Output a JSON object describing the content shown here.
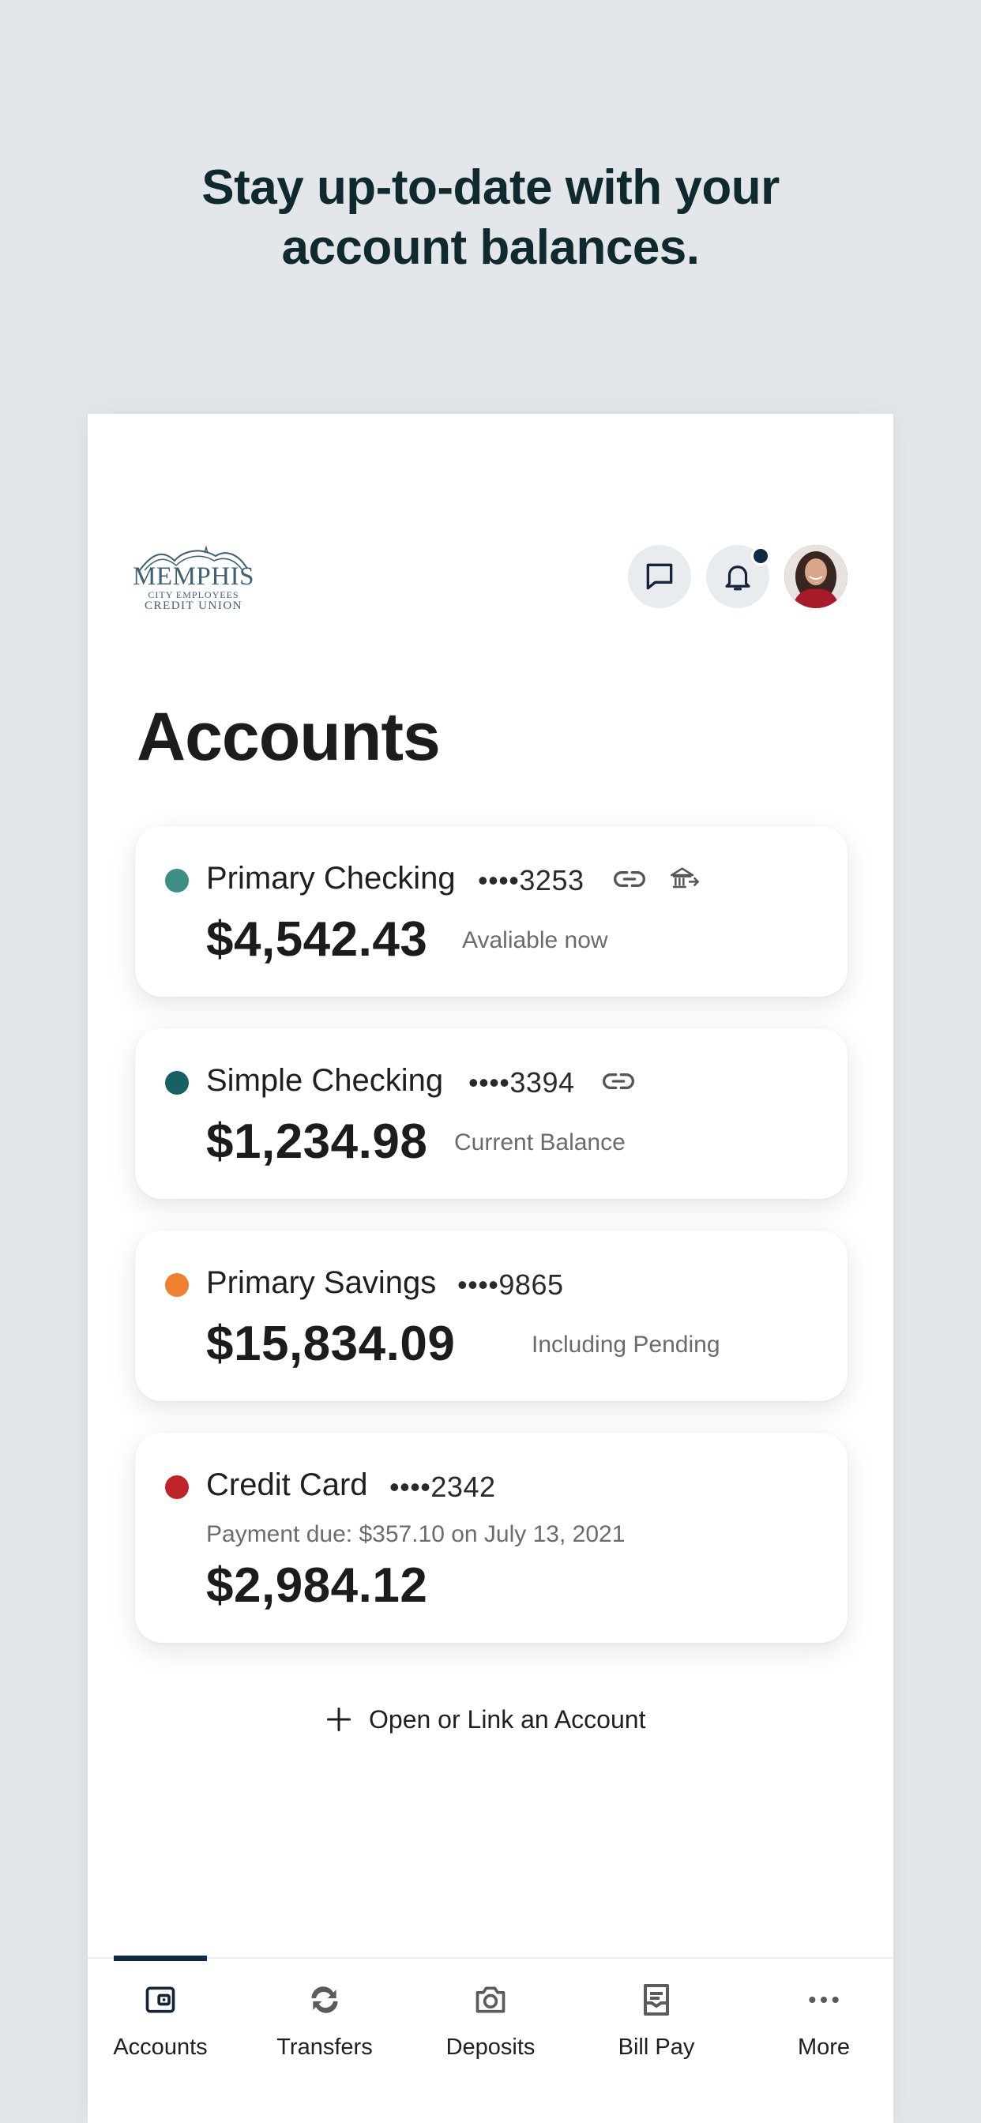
{
  "headline": {
    "line1": "Stay up-to-date with your",
    "line2": "account balances."
  },
  "logo": {
    "line1": "MEMPHIS",
    "line2": "CITY EMPLOYEES",
    "line3": "CREDIT UNION"
  },
  "header": {
    "icons": [
      "chat-icon",
      "bell-icon",
      "profile-avatar"
    ],
    "has_notification": true
  },
  "page_title": "Accounts",
  "accounts": [
    {
      "name": "Primary Checking",
      "masked": "••••3253",
      "amount": "$4,542.43",
      "note": "Avaliable now",
      "color": "#3d8f86",
      "icons": [
        "link-icon",
        "bank-transfer-icon"
      ]
    },
    {
      "name": "Simple Checking",
      "masked": "••••3394",
      "amount": "$1,234.98",
      "note": "Current Balance",
      "color": "#176066",
      "icons": [
        "link-icon"
      ]
    },
    {
      "name": "Primary Savings",
      "masked": "••••9865",
      "amount": "$15,834.09",
      "note": "Including Pending",
      "color": "#f08030",
      "icons": []
    },
    {
      "name": "Credit Card",
      "masked": "••••2342",
      "due_text": "Payment due: $357.10 on July 13, 2021",
      "amount": "$2,984.12",
      "color": "#c0232a",
      "icons": []
    }
  ],
  "open_link_label": "Open or Link an Account",
  "tabs": [
    {
      "label": "Accounts",
      "icon": "wallet-icon",
      "active": true
    },
    {
      "label": "Transfers",
      "icon": "transfer-icon",
      "active": false
    },
    {
      "label": "Deposits",
      "icon": "camera-icon",
      "active": false
    },
    {
      "label": "Bill Pay",
      "icon": "bill-icon",
      "active": false
    },
    {
      "label": "More",
      "icon": "more-icon",
      "active": false
    }
  ],
  "colors": {
    "background": "#e3e7ea",
    "headline": "#0f2a2e",
    "accent": "#0f2a45"
  }
}
